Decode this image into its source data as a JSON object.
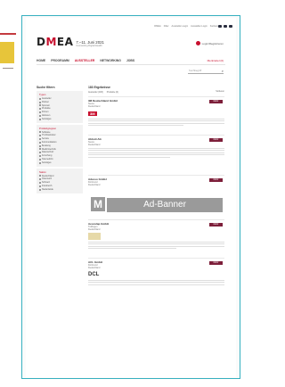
{
  "topbar": {
    "links": [
      "DMEA",
      "Filter",
      "Aussteller-Login",
      "Aussteller-Login",
      "Karriere"
    ]
  },
  "brand": {
    "logo_a": "D",
    "logo_m": "M",
    "logo_rest": "EA",
    "date": "7.–11. Juni 2021",
    "tagline": "Connecting Digital Health"
  },
  "login": {
    "label": "Login/Registrieren"
  },
  "nav": {
    "items": [
      "HOME",
      "PROGRAMM",
      "AUSSTELLER",
      "NETWORKING",
      "JOBS"
    ],
    "active_index": 2,
    "merkliste": "Merkzettel (0)"
  },
  "search": {
    "placeholder": "Suchbegriff"
  },
  "sidebar": {
    "title": "Suche filtern",
    "sections": [
      {
        "label": "Typen",
        "items": [
          "Aussteller",
          "Partner",
          "Sponsor",
          "Produkte",
          "Firmen",
          "Aktionen",
          "Sonstiges"
        ]
      },
      {
        "label": "Produktgruppen",
        "items": [
          "Software",
          "IT-Infrastruktur",
          "Service",
          "Kommunikation",
          "Beratung",
          "Medizintechnik",
          "Datenschutz",
          "Forschung",
          "Telemedizin",
          "Sonstiges"
        ]
      },
      {
        "label": "Nation",
        "items": [
          "Deutschland",
          "Österreich",
          "Schweiz",
          "Frankreich",
          "Niederlande"
        ]
      }
    ]
  },
  "results": {
    "count": "183 Ergebnisse",
    "filters": [
      "Aussteller (183)",
      "Produkte (0)"
    ],
    "sort": "Sortieren",
    "more_label": "Mehr",
    "entries": [
      {
        "name": "3M Deutschland GmbH",
        "location": "Neuss\nDeutschland",
        "logo": "3M"
      },
      {
        "name": "Abbott AG",
        "location": "Neuss\nDeutschland",
        "logo": ""
      },
      {
        "name": "Adesso GmbH",
        "location": "Dortmund\nDeutschland",
        "logo": ""
      },
      {
        "name": "Aesculap GmbH",
        "location": "Tuttlingen\nDeutschland",
        "logo": ""
      },
      {
        "name": "ACL GmbH",
        "location": "Dortmund\nDeutschland",
        "logo": "DCL"
      }
    ]
  },
  "ad": {
    "logo_letter": "M",
    "banner": "Ad-Banner"
  },
  "colors": {
    "brand_red": "#c8102e",
    "button": "#7d1f3a",
    "frame": "#36b0c0",
    "ad_gray": "#9a9a9a"
  }
}
